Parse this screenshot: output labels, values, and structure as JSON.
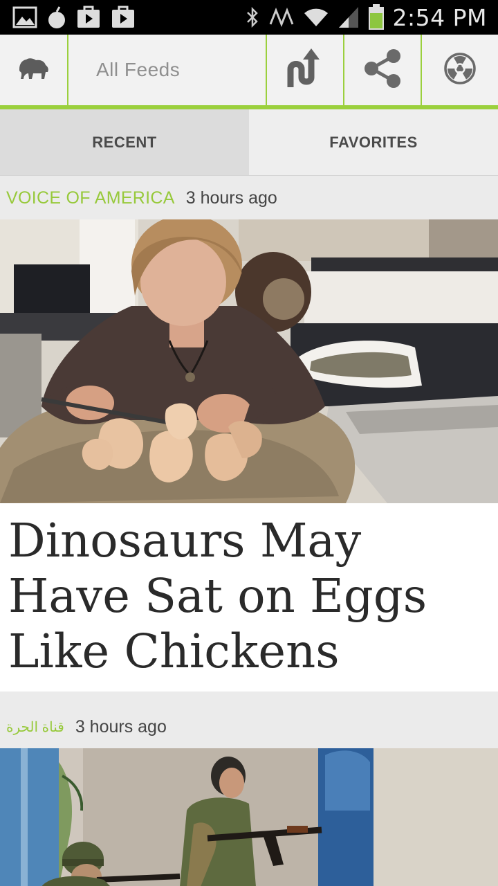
{
  "status_bar": {
    "time": "2:54 PM",
    "battery_color": "#8dc63f"
  },
  "action_bar": {
    "logo_icon": "bison-icon",
    "feed_selector_label": "All Feeds",
    "accent_color": "#9bd03d",
    "buttons": [
      {
        "name": "trending-icon"
      },
      {
        "name": "share-icon"
      },
      {
        "name": "radiation-icon"
      }
    ]
  },
  "tabs": [
    {
      "label": "RECENT",
      "active": true
    },
    {
      "label": "FAVORITES",
      "active": false
    }
  ],
  "feed": {
    "items": [
      {
        "source": "VOICE OF AMERICA",
        "time": "3 hours ago",
        "image": "paleontologist-with-dinosaur-eggs",
        "title": "Dinosaurs May Have Sat on Eggs Like Chickens"
      },
      {
        "source": "قناة الحرة",
        "time": "3 hours ago",
        "image": "soldiers-with-rifles"
      }
    ]
  }
}
